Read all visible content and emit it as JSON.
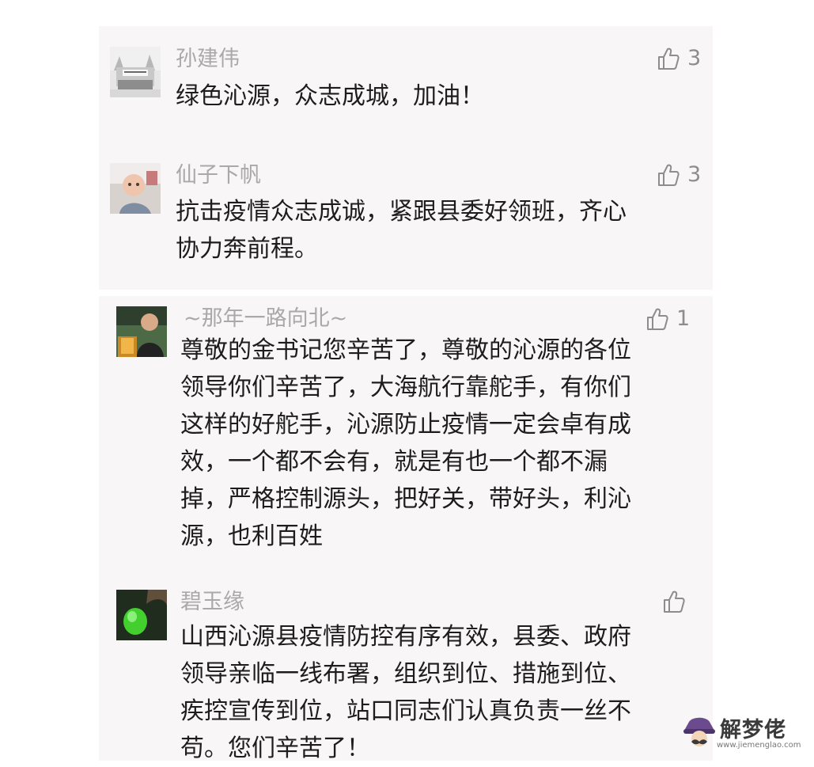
{
  "comments": [
    {
      "name": "孙建伟",
      "lines": [
        "绿色沁源，众志成城，加油！"
      ],
      "likes": "3",
      "avatar_icon": "gate-photo-avatar"
    },
    {
      "name": "仙子下帆",
      "lines": [
        "抗击疫情众志成诚，紧跟县委好领班，齐心",
        "协力奔前程。"
      ],
      "likes": "3",
      "avatar_icon": "baby-photo-avatar"
    },
    {
      "name": "~那年一路向北~",
      "lines": [
        "尊敬的金书记您辛苦了，尊敬的沁源的各位",
        "领导你们辛苦了，大海航行靠舵手，有你们",
        "这样的好舵手，沁源防止疫情一定会卓有成",
        "效，一个都不会有，就是有也一个都不漏",
        "掉，严格控制源头，把好关，带好头，利沁",
        "源，也利百姓"
      ],
      "likes": "1",
      "avatar_icon": "man-photo-avatar"
    },
    {
      "name": "碧玉缘",
      "lines": [
        "山西沁源县疫情防控有序有效，县委、政府",
        "领导亲临一线布署，组织到位、措施到位、",
        "疾控宣传到位，站口同志们认真负责一丝不",
        "苟。您们辛苦了！"
      ],
      "likes": "",
      "avatar_icon": "jade-photo-avatar"
    }
  ],
  "watermark": {
    "title": "解梦佬",
    "url": "www.jiemenglao.com"
  },
  "colors": {
    "panel": "#f8f6f6",
    "name": "#a9a9a9",
    "text": "#1d1d1d",
    "like": "#8d8d8d"
  }
}
